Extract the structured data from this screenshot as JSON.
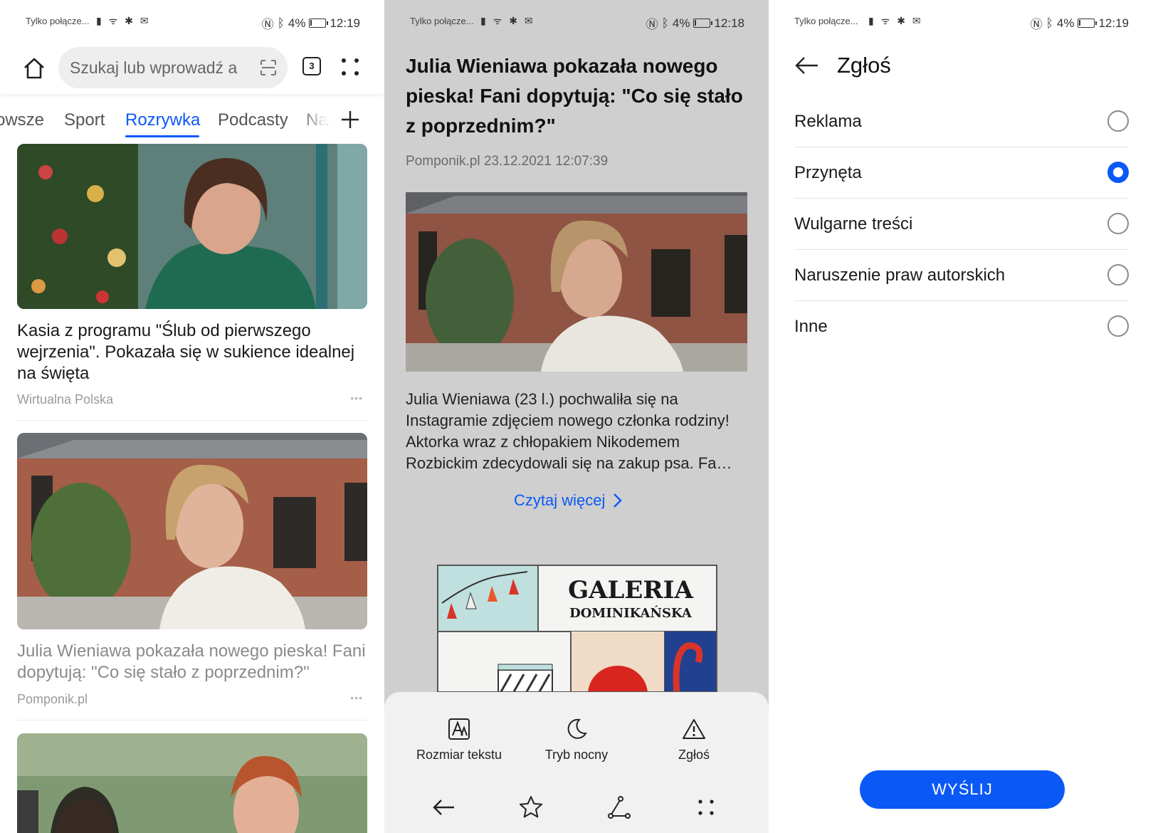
{
  "status_bars": [
    {
      "carrier": "Tylko połącze...",
      "battery": "4%",
      "time": "12:19"
    },
    {
      "carrier": "Tylko połącze...",
      "battery": "4%",
      "time": "12:18"
    },
    {
      "carrier": "Tylko połącze...",
      "battery": "4%",
      "time": "12:19"
    }
  ],
  "feed": {
    "search_placeholder": "Szukaj lub wprowadź a",
    "tab_count": "3",
    "categories": [
      "owsze",
      "Sport",
      "Rozrywka",
      "Podcasty",
      "Na"
    ],
    "active_category": "Rozrywka",
    "articles": [
      {
        "title": "Kasia z programu \"Ślub od pierwszego wejrzenia\". Pokazała się w sukience idealnej na święta",
        "source": "Wirtualna Polska",
        "read": false
      },
      {
        "title": "Julia Wieniawa pokazała nowego pieska! Fani dopytują: \"Co się stało z poprzednim?\"",
        "source": "Pomponik.pl",
        "read": true
      }
    ]
  },
  "article": {
    "title": "Julia Wieniawa pokazała nowego pieska! Fani dopytują: \"Co się stało z poprzednim?\"",
    "source": "Pomponik.pl",
    "date": "23.12.2021",
    "time": "12:07:39",
    "excerpt": "Julia Wieniawa (23 l.) pochwaliła się na Instagramie zdjęciem nowego członka rodziny! Aktorka wraz z chłopakiem Nikodemem Rozbickim zdecydowali się na zakup psa. Fa…",
    "read_more": "Czytaj więcej",
    "ad_brand": "GALERIA",
    "ad_sub": "DOMINIKAŃSKA"
  },
  "sheet": {
    "text_size": "Rozmiar tekstu",
    "night_mode": "Tryb nocny",
    "report": "Zgłoś"
  },
  "report": {
    "title": "Zgłoś",
    "options": [
      {
        "label": "Reklama",
        "selected": false
      },
      {
        "label": "Przynęta",
        "selected": true
      },
      {
        "label": "Wulgarne treści",
        "selected": false
      },
      {
        "label": "Naruszenie praw autorskich",
        "selected": false
      },
      {
        "label": "Inne",
        "selected": false
      }
    ],
    "send": "WYŚLIJ"
  },
  "colors": {
    "accent": "#0a59f7",
    "overlay": "#cfcfcf"
  }
}
